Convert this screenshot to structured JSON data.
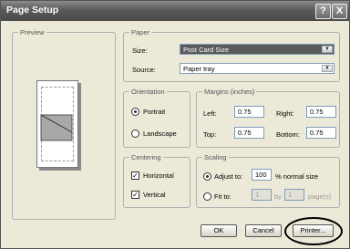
{
  "window": {
    "title": "Page Setup",
    "help_label": "?",
    "close_label": "X"
  },
  "preview": {
    "label": "Preview"
  },
  "paper": {
    "label": "Paper",
    "size_label": "Size:",
    "size_value": "Post Card Size",
    "source_label": "Source:",
    "source_value": "Paper tray"
  },
  "orientation": {
    "label": "Orientation",
    "portrait_label": "Portrait",
    "landscape_label": "Landscape",
    "selected": "Portrait"
  },
  "margins": {
    "label": "Margins (inches)",
    "left_label": "Left:",
    "left_value": "0.75",
    "right_label": "Right:",
    "right_value": "0.75",
    "top_label": "Top:",
    "top_value": "0.75",
    "bottom_label": "Bottom:",
    "bottom_value": "0.75"
  },
  "centering": {
    "label": "Centering",
    "horizontal_label": "Horizontal",
    "horizontal_checked": true,
    "vertical_label": "Vertical",
    "vertical_checked": true
  },
  "scaling": {
    "label": "Scaling",
    "adjust_label": "Adjust to:",
    "adjust_value": "100",
    "percent_label": "% normal size",
    "fit_label": "Fit to:",
    "fit_wide_value": "1",
    "by_label": "by",
    "fit_tall_value": "1",
    "pages_label": "page(s)"
  },
  "buttons": {
    "ok": "OK",
    "cancel": "Cancel",
    "printer": "Printer..."
  },
  "colors": {
    "titlebar": "#5a5a5a",
    "dialog_bg": "#ece9d8",
    "highlight_circle": "#000000"
  }
}
